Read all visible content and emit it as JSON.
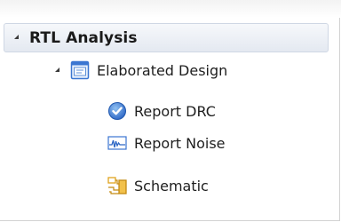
{
  "tree": {
    "root_label": "RTL Analysis",
    "child_label": "Elaborated Design",
    "items": [
      {
        "label": "Report DRC",
        "icon": "check-shield-icon"
      },
      {
        "label": "Report Noise",
        "icon": "waveform-icon"
      },
      {
        "label": "Schematic",
        "icon": "schematic-icon"
      }
    ]
  },
  "colors": {
    "header_bg_top": "#f6f8fb",
    "header_bg_bottom": "#e4e9f1",
    "header_border": "#cfd7e4",
    "icon_blue": "#3b76d1",
    "icon_gold": "#e0a31d"
  }
}
